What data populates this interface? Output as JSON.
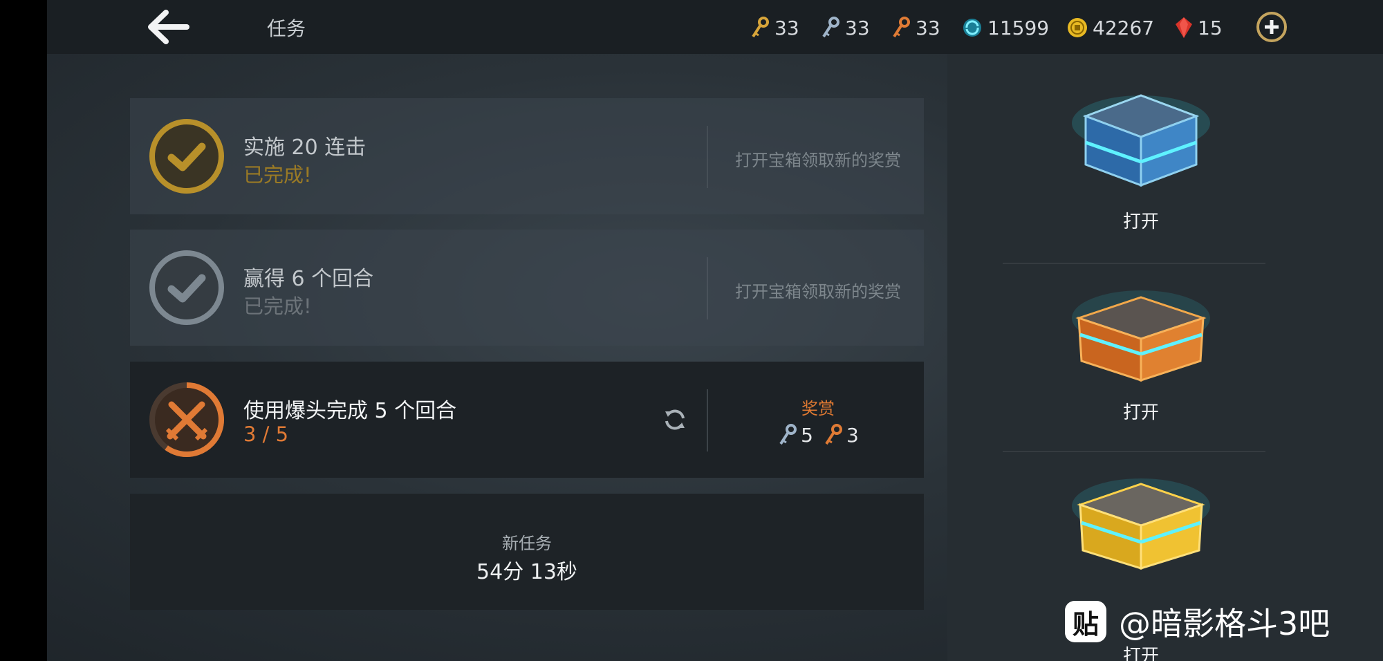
{
  "header": {
    "title": "任务",
    "currencies": [
      {
        "icon": "gold-key-icon",
        "value": "33",
        "color": "#d8a53a"
      },
      {
        "icon": "silver-key-icon",
        "value": "33",
        "color": "#9fb4c9"
      },
      {
        "icon": "bronze-key-icon",
        "value": "33",
        "color": "#e07b35"
      },
      {
        "icon": "energy-orb-icon",
        "value": "11599",
        "color": "#2ab0c9"
      },
      {
        "icon": "gold-coin-icon",
        "value": "42267",
        "color": "#e8b923"
      },
      {
        "icon": "ruby-gem-icon",
        "value": "15",
        "color": "#d8342a"
      }
    ]
  },
  "quests": [
    {
      "title": "实施 20 连击",
      "status": "已完成!",
      "status_color": "#9a7a25",
      "hint": "打开宝箱领取新的奖赏",
      "badge_color": "#b8902a"
    },
    {
      "title": "赢得 6 个回合",
      "status": "已完成!",
      "status_color": "#6c7379",
      "hint": "打开宝箱领取新的奖赏",
      "badge_color": "#7d8891"
    },
    {
      "title": "使用爆头完成 5 个回合",
      "progress_text": "3 / 5",
      "progress": 0.6,
      "status_color": "#e07a35",
      "reward_title": "奖赏",
      "rewards": [
        {
          "icon": "silver-key-icon",
          "value": "5"
        },
        {
          "icon": "bronze-key-icon",
          "value": "3"
        }
      ]
    }
  ],
  "new_quest": {
    "label": "新任务",
    "time": "54分 13秒"
  },
  "chests": [
    {
      "type": "blue-chest",
      "label": "打开"
    },
    {
      "type": "bronze-chest",
      "label": "打开"
    },
    {
      "type": "gold-chest",
      "label": "打开"
    }
  ],
  "watermark": {
    "icon_text": "贴",
    "text": "@暗影格斗3吧"
  }
}
